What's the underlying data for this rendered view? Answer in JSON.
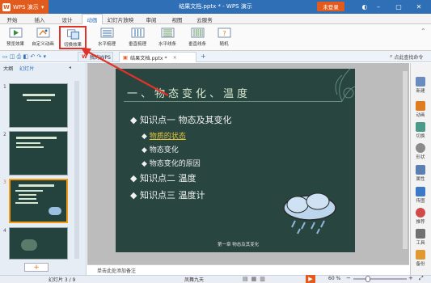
{
  "titlebar": {
    "app_name": "WPS 演示",
    "window_title": "结果文档.pptx * - WPS 演示",
    "login": "未登录"
  },
  "menu": [
    "开始",
    "插入",
    "设计",
    "动画",
    "幻灯片放映",
    "审阅",
    "视图",
    "云服务"
  ],
  "menu_active": "动画",
  "ribbon": [
    "预览效果",
    "自定义动画",
    "切换效果",
    "水平梳理",
    "垂直梳理",
    "水平线条",
    "垂直线条",
    "随机"
  ],
  "tabs": {
    "my_wps": "我的WPS",
    "doc": "结果文档.pptx *",
    "search_placeholder": "点此查找命令"
  },
  "left_panel": {
    "tab_outline": "大纲",
    "tab_slides": "幻灯片",
    "thumb_nums": [
      "1",
      "2",
      "3",
      "4"
    ],
    "add": "+"
  },
  "slide": {
    "title": "一、物态变化、温度",
    "lines": [
      {
        "text": "知识点一 物态及其变化",
        "level": 1
      },
      {
        "text": "物质的状态",
        "level": 2,
        "link": true
      },
      {
        "text": "物态变化",
        "level": 2
      },
      {
        "text": "物态变化的原因",
        "level": 2
      },
      {
        "text": "知识点二 温度",
        "level": 1
      },
      {
        "text": "知识点三 温度计",
        "level": 1
      }
    ],
    "footer": "第一章 物态及其变化"
  },
  "notes_placeholder": "单击此处添加备注",
  "right_bar": [
    "新建",
    "动画",
    "切换",
    "形状",
    "属性",
    "传图",
    "推荐",
    "工具",
    "备份"
  ],
  "status": {
    "slide_counter": "幻灯片 3 / 9",
    "theme": "凤舞九天",
    "zoom": "60 %"
  },
  "colors": {
    "title_bar": "#2f6fb5",
    "app_orange": "#e25b1d",
    "slide_bg": "#28463f",
    "highlight_red": "#e0312a"
  }
}
